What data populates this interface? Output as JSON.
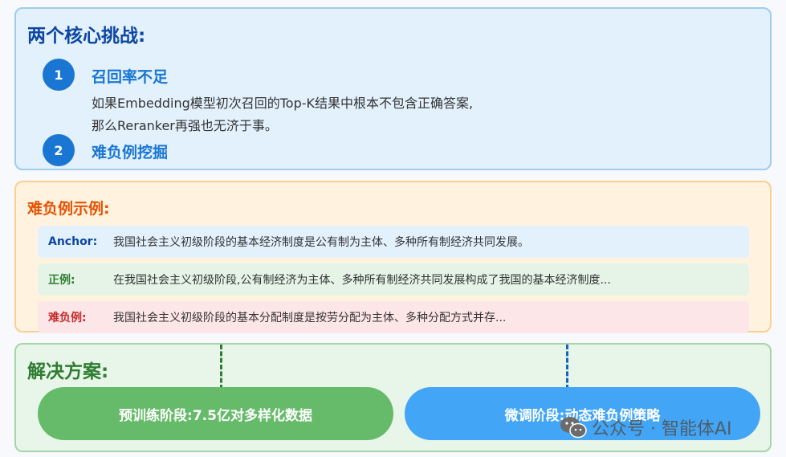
{
  "challenges": {
    "title": "两个核心挑战:",
    "items": [
      {
        "number": "1",
        "title": "召回率不足",
        "desc": [
          "如果Embedding模型初次召回的Top-K结果中根本不包含正确答案,",
          "那么Reranker再强也无济于事。"
        ]
      },
      {
        "number": "2",
        "title": "难负例挖掘"
      }
    ]
  },
  "examples": {
    "title": "难负例示例:",
    "rows": [
      {
        "label": "Anchor:",
        "text": "我国社会主义初级阶段的基本经济制度是公有制为主体、多种所有制经济共同发展。"
      },
      {
        "label": "正例:",
        "text": "在我国社会主义初级阶段,公有制经济为主体、多种所有制经济共同发展构成了我国的基本经济制度..."
      },
      {
        "label": "难负例:",
        "text": "我国社会主义初级阶段的基本分配制度是按劳分配为主体、多种分配方式并存..."
      }
    ]
  },
  "solution": {
    "title": "解决方案:",
    "stages": [
      "预训练阶段:7.5亿对多样化数据",
      "微调阶段:动态难负例策略"
    ]
  },
  "watermark": {
    "text": "公众号 · 智能体AI",
    "icon": "wechat-icon"
  },
  "colors": {
    "blue_accent": "#1976d2",
    "orange_accent": "#e65100",
    "green_accent": "#2e7d32",
    "pill_green": "#66bb6a",
    "pill_blue": "#42a5f5"
  }
}
